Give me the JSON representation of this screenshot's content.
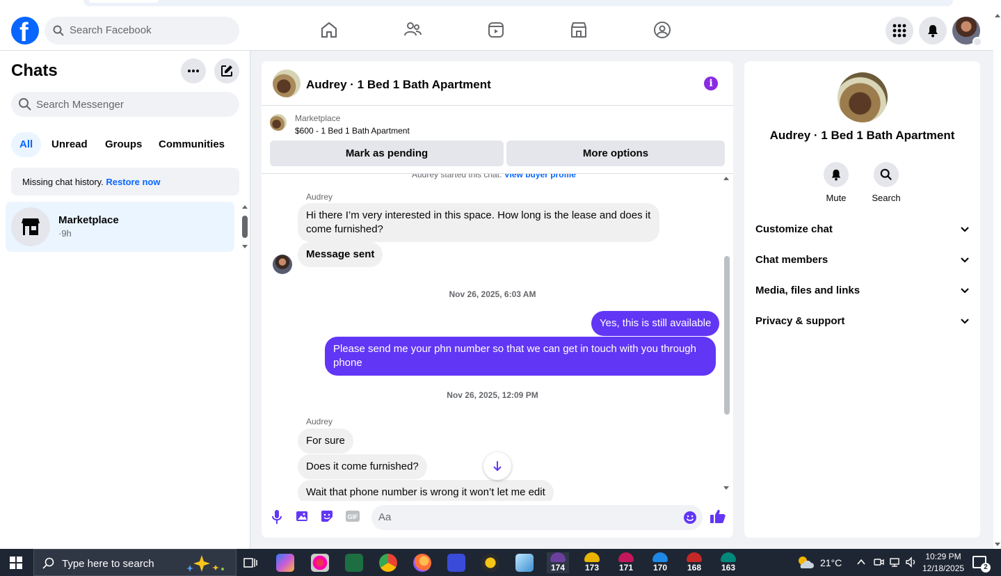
{
  "topnav": {
    "logo": "f",
    "search_placeholder": "Search Facebook",
    "icons": [
      "home-icon",
      "friends-icon",
      "video-icon",
      "marketplace-icon",
      "groups-icon"
    ],
    "right_icons": [
      "menu-grid-icon",
      "notifications-bell-icon",
      "profile-avatar"
    ]
  },
  "sidebar": {
    "title": "Chats",
    "search_placeholder": "Search Messenger",
    "filters": [
      "All",
      "Unread",
      "Groups",
      "Communities"
    ],
    "active_filter": "All",
    "missing_text": "Missing chat history.",
    "missing_link": "Restore now",
    "chats": [
      {
        "name": "Marketplace",
        "time": "·9h"
      }
    ]
  },
  "conversation": {
    "title": "Audrey · 1 Bed 1 Bath Apartment",
    "marketplace_label": "Marketplace",
    "listing": "$600 - 1 Bed 1 Bath Apartment",
    "mark_pending": "Mark as pending",
    "more_options": "More options",
    "started_text": "Audrey started this chat.",
    "started_link": "View buyer profile",
    "messages": {
      "sender1": "Audrey",
      "m1": "Hi there I’m very interested in this space. How long is the lease and does it come furnished?",
      "m2": "Message sent",
      "ts1": "Nov 26, 2025, 6:03 AM",
      "out1": "Yes, this is still available",
      "out2": "Please send me your phn number so that we can get in touch with you through phone",
      "ts2": "Nov 26, 2025, 12:09 PM",
      "sender2": "Audrey",
      "m3": "For sure",
      "m4": "Does it come furnished?",
      "m5": "Wait that phone number is wrong it won’t let me edit"
    },
    "composer_placeholder": "Aa",
    "accent": "#6236f5"
  },
  "details": {
    "title": "Audrey · 1 Bed 1 Bath Apartment",
    "mute": "Mute",
    "search": "Search",
    "sections": [
      "Customize chat",
      "Chat members",
      "Media, files and links",
      "Privacy & support"
    ]
  },
  "taskbar": {
    "search_placeholder": "Type here to search",
    "badges": [
      "174",
      "173",
      "171",
      "170",
      "168",
      "163"
    ],
    "temperature": "21°C",
    "time": "10:29 PM",
    "date": "12/18/2025",
    "notifications": "2"
  }
}
